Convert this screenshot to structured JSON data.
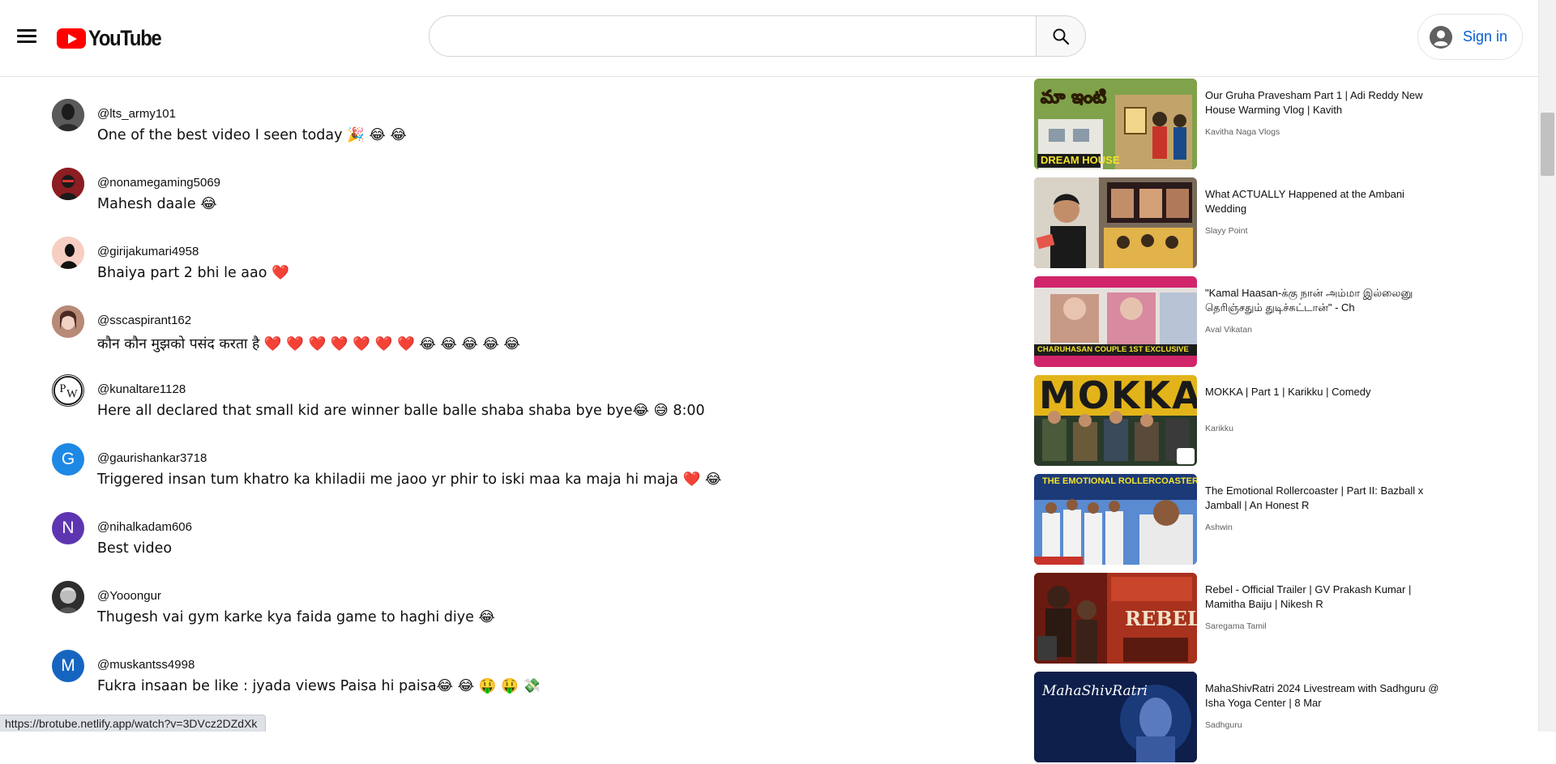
{
  "header": {
    "menu_icon": "hamburger-menu-icon",
    "logo_text": "YouTube",
    "search_placeholder": "",
    "search_icon": "search-icon",
    "sign_in_label": "Sign in",
    "account_icon": "account-circle-icon"
  },
  "comments": [
    {
      "author": "@lts_army101",
      "text": "One of the best video I seen today 🎉 😂 😂",
      "avatar_color": "#3a3a3a",
      "avatar_letter": ""
    },
    {
      "author": "@nonamegaming5069",
      "text": "Mahesh daale 😂",
      "avatar_color": "#7b1218",
      "avatar_letter": ""
    },
    {
      "author": "@girijakumari4958",
      "text": "Bhaiya part 2 bhi le aao ❤️",
      "avatar_color": "#f3c4b8",
      "avatar_letter": ""
    },
    {
      "author": "@sscaspirant162",
      "text": "कौन कौन मुझको पसंद करता है ❤️ ❤️ ❤️ ❤️ ❤️ ❤️ ❤️ 😂 😂 😂 😂 😂",
      "avatar_color": "#c79a86",
      "avatar_letter": ""
    },
    {
      "author": "@kunaltare1128",
      "text": "Here all declared that small kid are winner balle balle shaba shaba bye bye😂 😅  8:00",
      "avatar_color": "#ffffff",
      "avatar_letter": "PW"
    },
    {
      "author": "@gaurishankar3718",
      "text": "Triggered insan tum khatro ka khiladii me jaoo yr phir to iski maa ka maja hi maja ❤️ 😂",
      "avatar_color": "#1e88e5",
      "avatar_letter": "G"
    },
    {
      "author": "@nihalkadam606",
      "text": "Best video",
      "avatar_color": "#5e35b1",
      "avatar_letter": "N"
    },
    {
      "author": "@Yooongur",
      "text": "Thugesh vai gym karke kya faida game to haghi diye 😂",
      "avatar_color": "#4a4a4a",
      "avatar_letter": ""
    },
    {
      "author": "@muskantss4998",
      "text": "Fukra insaan be like : jyada views Paisa hi paisa😂 😂  🤑 🤑 💸",
      "avatar_color": "#1565c0",
      "avatar_letter": "M"
    }
  ],
  "recommendations": [
    {
      "title": "Our Gruha Pravesham Part 1 | Adi Reddy New House Warming Vlog | Kavith",
      "channel": "Kavitha Naga Vlogs",
      "thumb_caption": "DREAM HOUSE",
      "thumb_bg": "#6a8a3a"
    },
    {
      "title": "What ACTUALLY Happened at the Ambani Wedding",
      "channel": "Slayy Point",
      "thumb_caption": "",
      "thumb_bg": "#b08a4a"
    },
    {
      "title": "\"Kamal Haasan-க்கு நான் அம்மா இல்லைனு தெரிஞ்சதும் துடிச்சுட்டான்\" - Ch",
      "channel": "Aval Vikatan",
      "thumb_caption": "CHARUHASAN COUPLE 1ST EXCLUSIVE",
      "thumb_bg": "#d0256a"
    },
    {
      "title": "MOKKA | Part 1 | Karikku | Comedy",
      "channel": "Karikku",
      "thumb_caption": "MOKKA",
      "thumb_bg": "#e3b41a"
    },
    {
      "title": "The Emotional Rollercoaster | Part II: Bazball x Jamball | An Honest R",
      "channel": "Ashwin",
      "thumb_caption": "THE EMOTIONAL ROLLERCOASTER",
      "thumb_bg": "#2a5aa8"
    },
    {
      "title": "Rebel - Official Trailer | GV Prakash Kumar | Mamitha Baiju | Nikesh R",
      "channel": "Saregama Tamil",
      "thumb_caption": "REBEL",
      "thumb_bg": "#8a2a1a"
    },
    {
      "title": "MahaShivRatri 2024 Livestream with Sadhguru @ Isha Yoga Center | 8 Mar",
      "channel": "Sadhguru",
      "thumb_caption": "MahaShivRatri",
      "thumb_bg": "#0d1f4a"
    }
  ],
  "status_bar": {
    "url": "https://brotube.netlify.app/watch?v=3DVcz2DZdXk"
  }
}
